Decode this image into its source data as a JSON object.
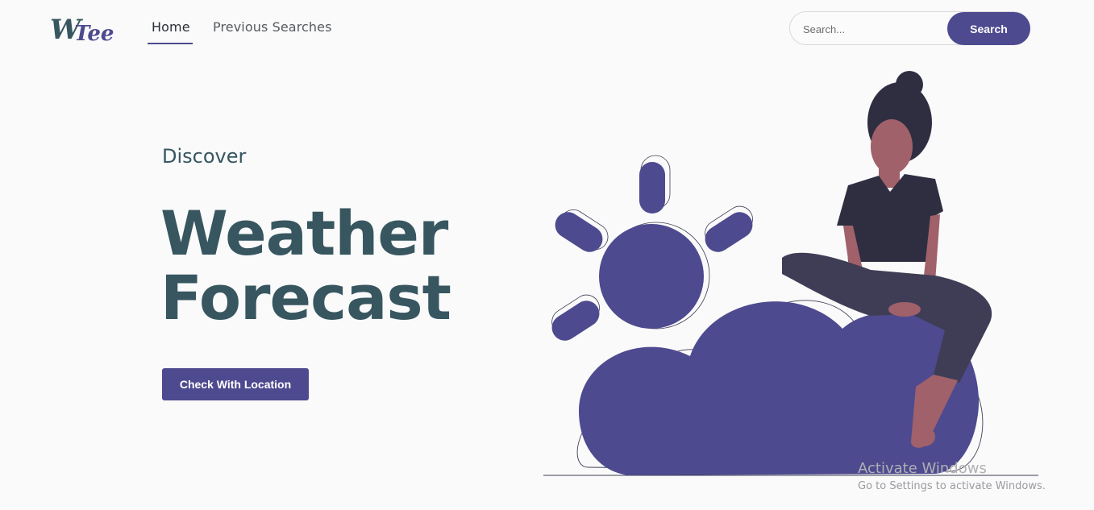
{
  "header": {
    "logo_text": "WTee",
    "nav": {
      "home_label": "Home",
      "previous_label": "Previous Searches"
    },
    "search": {
      "placeholder": "Search...",
      "button_label": "Search"
    }
  },
  "hero": {
    "eyebrow": "Discover",
    "title_line1": "Weather",
    "title_line2": "Forecast",
    "cta_label": "Check With Location"
  },
  "watermark": {
    "title": "Activate Windows",
    "subtitle": "Go to Settings to activate Windows."
  },
  "colors": {
    "accent": "#4e4a8f",
    "heading": "#375660",
    "figure_dark": "#2f2e41",
    "skin": "#a0616a"
  },
  "icons": [
    "sun-icon",
    "cloud-icon"
  ]
}
